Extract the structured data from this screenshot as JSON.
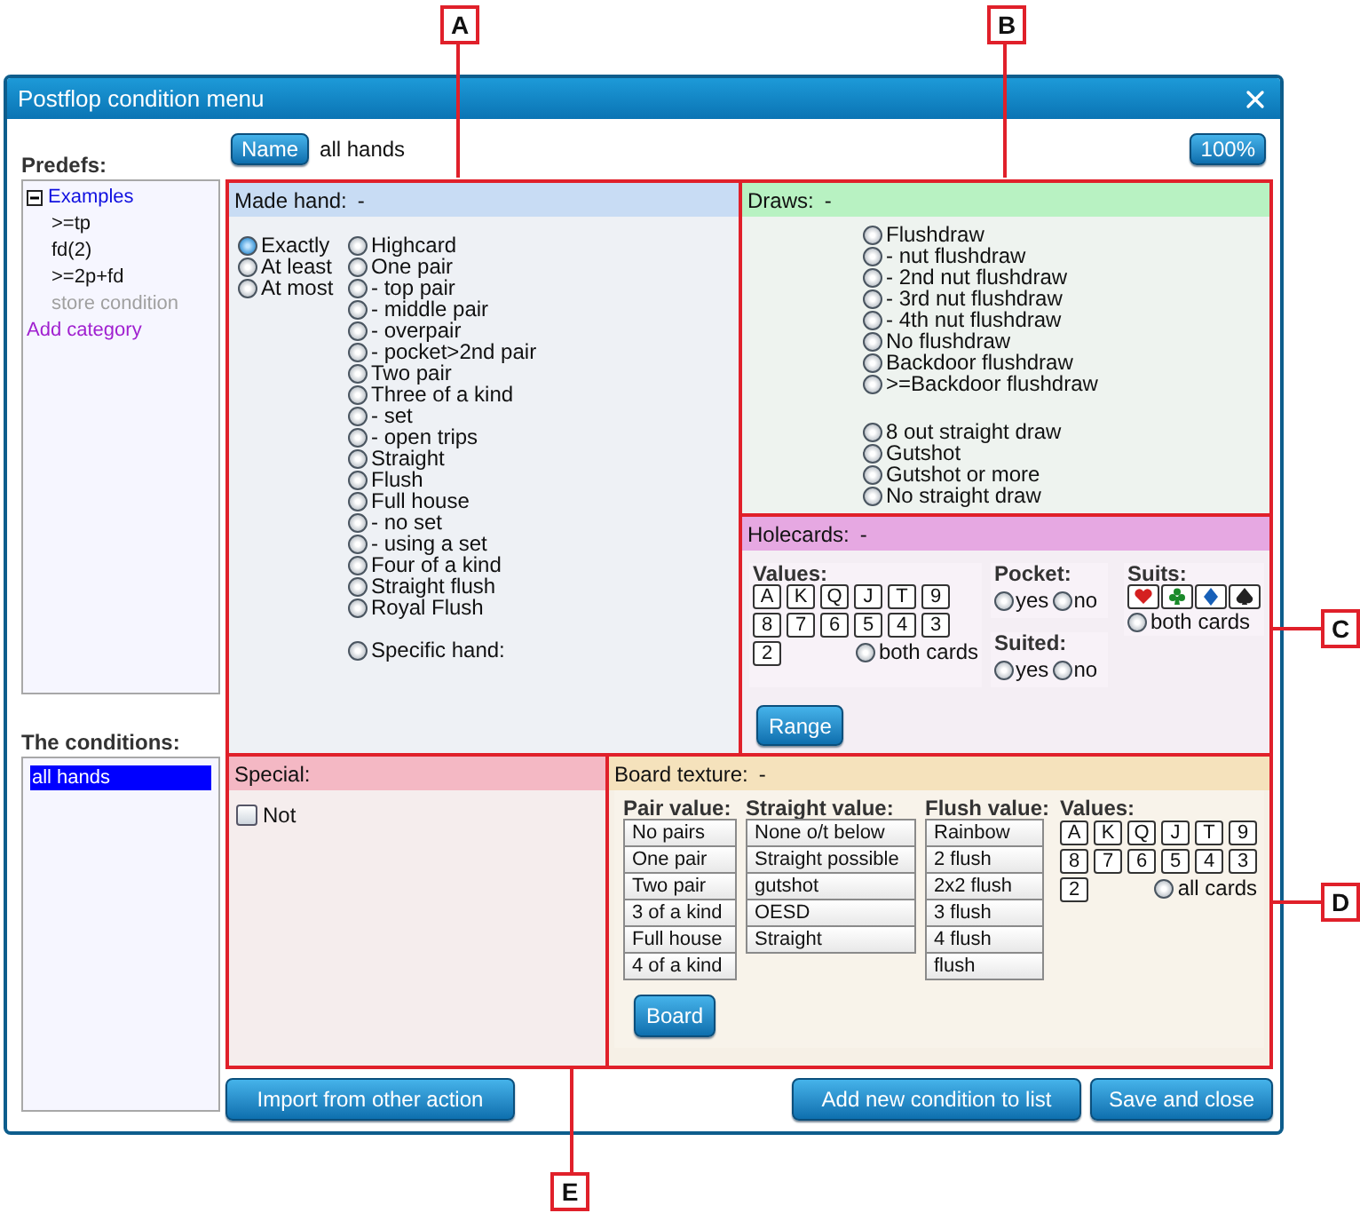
{
  "window": {
    "title": "Postflop condition menu"
  },
  "predefs": {
    "label": "Predefs:",
    "tree": [
      {
        "label": "Examples",
        "expanded": true,
        "children": [
          {
            "label": ">=tp",
            "disabled": false
          },
          {
            "label": "fd(2)",
            "disabled": false
          },
          {
            "label": ">=2p+fd",
            "disabled": false
          },
          {
            "label": "store condition",
            "disabled": true
          }
        ]
      }
    ],
    "add_category": "Add category"
  },
  "conditions": {
    "label": "The conditions:",
    "items": [
      {
        "label": "all hands",
        "selected": true
      }
    ]
  },
  "name_button": "Name",
  "name_value": "all hands",
  "zoom_button": "100%",
  "made_hand": {
    "title": "Made hand:",
    "value": "-",
    "modes": [
      {
        "label": "Exactly",
        "selected": true
      },
      {
        "label": "At least",
        "selected": false
      },
      {
        "label": "At most",
        "selected": false
      }
    ],
    "hands": [
      {
        "label": "Highcard",
        "selected": false
      },
      {
        "label": "One pair",
        "selected": false
      },
      {
        "label": "- top pair",
        "selected": false
      },
      {
        "label": "- middle pair",
        "selected": false
      },
      {
        "label": "- overpair",
        "selected": false
      },
      {
        "label": "- pocket>2nd pair",
        "selected": false
      },
      {
        "label": "Two pair",
        "selected": false
      },
      {
        "label": "Three of a kind",
        "selected": false
      },
      {
        "label": "- set",
        "selected": false
      },
      {
        "label": "- open trips",
        "selected": false
      },
      {
        "label": "Straight",
        "selected": false
      },
      {
        "label": "Flush",
        "selected": false
      },
      {
        "label": "Full house",
        "selected": false
      },
      {
        "label": "- no set",
        "selected": false
      },
      {
        "label": "- using a set",
        "selected": false
      },
      {
        "label": "Four of a kind",
        "selected": false
      },
      {
        "label": "Straight flush",
        "selected": false
      },
      {
        "label": "Royal Flush",
        "selected": false
      }
    ],
    "specific_hand": {
      "label": "Specific hand:",
      "selected": false
    }
  },
  "draws": {
    "title": "Draws:",
    "value": "-",
    "flush_draws": [
      {
        "label": "Flushdraw",
        "selected": false
      },
      {
        "label": "- nut flushdraw",
        "selected": false
      },
      {
        "label": "- 2nd nut flushdraw",
        "selected": false
      },
      {
        "label": "- 3rd nut flushdraw",
        "selected": false
      },
      {
        "label": "- 4th nut flushdraw",
        "selected": false
      },
      {
        "label": "No flushdraw",
        "selected": false
      },
      {
        "label": "Backdoor flushdraw",
        "selected": false
      },
      {
        "label": ">=Backdoor flushdraw",
        "selected": false
      }
    ],
    "straight_draws": [
      {
        "label": "8 out straight draw",
        "selected": false
      },
      {
        "label": "Gutshot",
        "selected": false
      },
      {
        "label": "Gutshot or more",
        "selected": false
      },
      {
        "label": "No straight draw",
        "selected": false
      }
    ]
  },
  "holecards": {
    "title": "Holecards:",
    "value": "-",
    "values_label": "Values:",
    "cards": [
      "A",
      "K",
      "Q",
      "J",
      "T",
      "9",
      "8",
      "7",
      "6",
      "5",
      "4",
      "3",
      "2"
    ],
    "both_cards": {
      "label": "both cards",
      "selected": false
    },
    "pocket": {
      "label": "Pocket:",
      "options": [
        {
          "label": "yes",
          "selected": false
        },
        {
          "label": "no",
          "selected": false
        }
      ]
    },
    "suited": {
      "label": "Suited:",
      "options": [
        {
          "label": "yes",
          "selected": false
        },
        {
          "label": "no",
          "selected": false
        }
      ]
    },
    "suits_label": "Suits:",
    "suits": [
      {
        "kind": "heart"
      },
      {
        "kind": "club"
      },
      {
        "kind": "diamond"
      },
      {
        "kind": "spade"
      }
    ],
    "suits_both": {
      "label": "both cards",
      "selected": false
    },
    "range_button": "Range"
  },
  "special": {
    "title": "Special:",
    "not": {
      "label": "Not",
      "checked": false
    }
  },
  "board_texture": {
    "title": "Board texture:",
    "value": "-",
    "pair_value": {
      "label": "Pair value:",
      "options": [
        "No pairs",
        "One pair",
        "Two pair",
        "3 of a kind",
        "Full house",
        "4 of a kind"
      ]
    },
    "straight_value": {
      "label": "Straight value:",
      "options": [
        "None o/t below",
        "Straight possible",
        "gutshot",
        "OESD",
        "Straight"
      ]
    },
    "flush_value": {
      "label": "Flush value:",
      "options": [
        "Rainbow",
        "2 flush",
        "2x2 flush",
        "3 flush",
        "4 flush",
        "flush"
      ]
    },
    "values_label": "Values:",
    "cards": [
      "A",
      "K",
      "Q",
      "J",
      "T",
      "9",
      "8",
      "7",
      "6",
      "5",
      "4",
      "3",
      "2"
    ],
    "all_cards": {
      "label": "all cards",
      "selected": false
    },
    "board_button": "Board"
  },
  "buttons": {
    "import": "Import from other action",
    "add": "Add new condition to list",
    "save": "Save and close"
  },
  "callouts": [
    {
      "label": "A"
    },
    {
      "label": "B"
    },
    {
      "label": "C"
    },
    {
      "label": "D"
    },
    {
      "label": "E"
    }
  ]
}
